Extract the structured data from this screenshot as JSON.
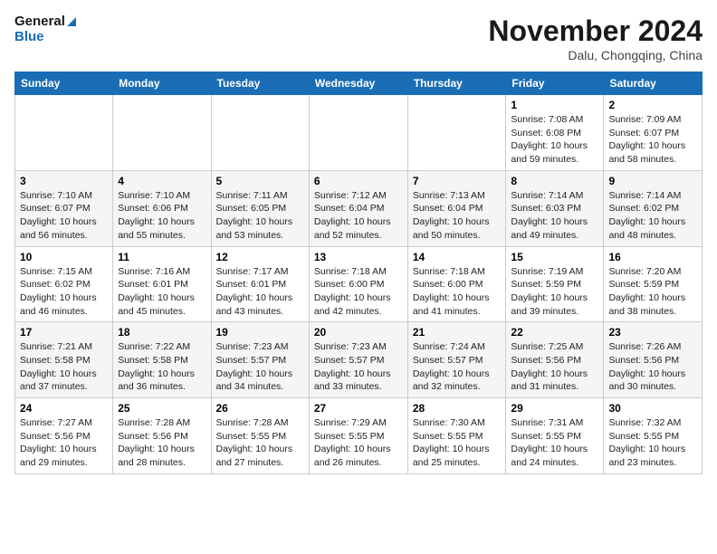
{
  "header": {
    "logo_line1": "General",
    "logo_line2": "Blue",
    "month": "November 2024",
    "location": "Dalu, Chongqing, China"
  },
  "weekdays": [
    "Sunday",
    "Monday",
    "Tuesday",
    "Wednesday",
    "Thursday",
    "Friday",
    "Saturday"
  ],
  "weeks": [
    [
      null,
      null,
      null,
      null,
      null,
      {
        "day": 1,
        "sunrise": "7:08 AM",
        "sunset": "6:08 PM",
        "daylight": "10 hours and 59 minutes."
      },
      {
        "day": 2,
        "sunrise": "7:09 AM",
        "sunset": "6:07 PM",
        "daylight": "10 hours and 58 minutes."
      }
    ],
    [
      {
        "day": 3,
        "sunrise": "7:10 AM",
        "sunset": "6:07 PM",
        "daylight": "10 hours and 56 minutes."
      },
      {
        "day": 4,
        "sunrise": "7:10 AM",
        "sunset": "6:06 PM",
        "daylight": "10 hours and 55 minutes."
      },
      {
        "day": 5,
        "sunrise": "7:11 AM",
        "sunset": "6:05 PM",
        "daylight": "10 hours and 53 minutes."
      },
      {
        "day": 6,
        "sunrise": "7:12 AM",
        "sunset": "6:04 PM",
        "daylight": "10 hours and 52 minutes."
      },
      {
        "day": 7,
        "sunrise": "7:13 AM",
        "sunset": "6:04 PM",
        "daylight": "10 hours and 50 minutes."
      },
      {
        "day": 8,
        "sunrise": "7:14 AM",
        "sunset": "6:03 PM",
        "daylight": "10 hours and 49 minutes."
      },
      {
        "day": 9,
        "sunrise": "7:14 AM",
        "sunset": "6:02 PM",
        "daylight": "10 hours and 48 minutes."
      }
    ],
    [
      {
        "day": 10,
        "sunrise": "7:15 AM",
        "sunset": "6:02 PM",
        "daylight": "10 hours and 46 minutes."
      },
      {
        "day": 11,
        "sunrise": "7:16 AM",
        "sunset": "6:01 PM",
        "daylight": "10 hours and 45 minutes."
      },
      {
        "day": 12,
        "sunrise": "7:17 AM",
        "sunset": "6:01 PM",
        "daylight": "10 hours and 43 minutes."
      },
      {
        "day": 13,
        "sunrise": "7:18 AM",
        "sunset": "6:00 PM",
        "daylight": "10 hours and 42 minutes."
      },
      {
        "day": 14,
        "sunrise": "7:18 AM",
        "sunset": "6:00 PM",
        "daylight": "10 hours and 41 minutes."
      },
      {
        "day": 15,
        "sunrise": "7:19 AM",
        "sunset": "5:59 PM",
        "daylight": "10 hours and 39 minutes."
      },
      {
        "day": 16,
        "sunrise": "7:20 AM",
        "sunset": "5:59 PM",
        "daylight": "10 hours and 38 minutes."
      }
    ],
    [
      {
        "day": 17,
        "sunrise": "7:21 AM",
        "sunset": "5:58 PM",
        "daylight": "10 hours and 37 minutes."
      },
      {
        "day": 18,
        "sunrise": "7:22 AM",
        "sunset": "5:58 PM",
        "daylight": "10 hours and 36 minutes."
      },
      {
        "day": 19,
        "sunrise": "7:23 AM",
        "sunset": "5:57 PM",
        "daylight": "10 hours and 34 minutes."
      },
      {
        "day": 20,
        "sunrise": "7:23 AM",
        "sunset": "5:57 PM",
        "daylight": "10 hours and 33 minutes."
      },
      {
        "day": 21,
        "sunrise": "7:24 AM",
        "sunset": "5:57 PM",
        "daylight": "10 hours and 32 minutes."
      },
      {
        "day": 22,
        "sunrise": "7:25 AM",
        "sunset": "5:56 PM",
        "daylight": "10 hours and 31 minutes."
      },
      {
        "day": 23,
        "sunrise": "7:26 AM",
        "sunset": "5:56 PM",
        "daylight": "10 hours and 30 minutes."
      }
    ],
    [
      {
        "day": 24,
        "sunrise": "7:27 AM",
        "sunset": "5:56 PM",
        "daylight": "10 hours and 29 minutes."
      },
      {
        "day": 25,
        "sunrise": "7:28 AM",
        "sunset": "5:56 PM",
        "daylight": "10 hours and 28 minutes."
      },
      {
        "day": 26,
        "sunrise": "7:28 AM",
        "sunset": "5:55 PM",
        "daylight": "10 hours and 27 minutes."
      },
      {
        "day": 27,
        "sunrise": "7:29 AM",
        "sunset": "5:55 PM",
        "daylight": "10 hours and 26 minutes."
      },
      {
        "day": 28,
        "sunrise": "7:30 AM",
        "sunset": "5:55 PM",
        "daylight": "10 hours and 25 minutes."
      },
      {
        "day": 29,
        "sunrise": "7:31 AM",
        "sunset": "5:55 PM",
        "daylight": "10 hours and 24 minutes."
      },
      {
        "day": 30,
        "sunrise": "7:32 AM",
        "sunset": "5:55 PM",
        "daylight": "10 hours and 23 minutes."
      }
    ]
  ]
}
